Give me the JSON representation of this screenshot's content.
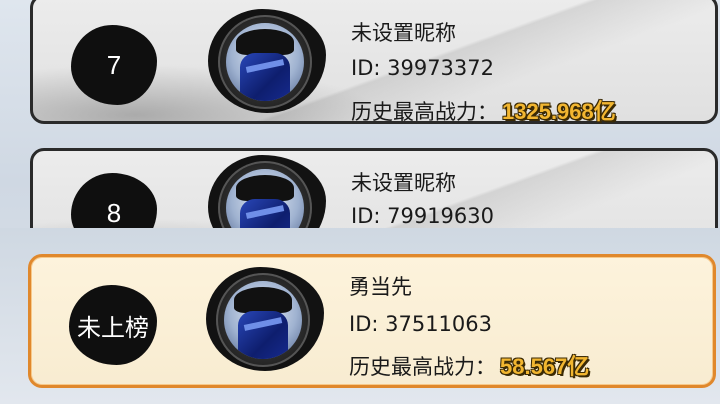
{
  "rows": [
    {
      "rank": "7",
      "nickname": "未设置昵称",
      "id_text": "ID: 39973372",
      "power_label": "历史最高战力：",
      "power_value": "1325.968亿"
    },
    {
      "rank": "8",
      "nickname": "未设置昵称",
      "id_text": "ID: 79919630"
    }
  ],
  "self_row": {
    "rank": "未上榜",
    "nickname": "勇当先",
    "id_text": "ID: 37511063",
    "power_label": "历史最高战力：",
    "power_value": "58.567亿"
  },
  "colors": {
    "self_border": "#e0882c",
    "power_value": "#f2b630"
  },
  "icons": {
    "avatar": "ninja-avatar-icon"
  }
}
